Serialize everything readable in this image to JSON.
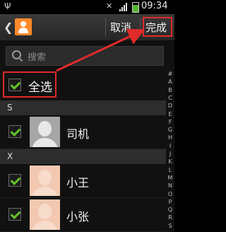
{
  "status_bar": {
    "time": "09:34"
  },
  "action_bar": {
    "cancel_label": "取消",
    "done_label": "完成"
  },
  "search": {
    "placeholder": "搜索"
  },
  "select_all": {
    "label": "全选",
    "checked": true
  },
  "sections": [
    {
      "letter": "S",
      "contacts": [
        {
          "name": "司机",
          "checked": true
        }
      ]
    },
    {
      "letter": "X",
      "contacts": [
        {
          "name": "小王",
          "checked": true
        },
        {
          "name": "小张",
          "checked": true
        }
      ]
    }
  ],
  "index_letters": [
    "#",
    "A",
    "B",
    "C",
    "D",
    "E",
    "F",
    "G",
    "H",
    "I",
    "J",
    "K",
    "L",
    "M",
    "N",
    "O",
    "P",
    "Q",
    "R",
    "S"
  ],
  "colors": {
    "highlight": "#e12a2a",
    "check": "#62c52b",
    "app_icon": "#ff8a2a"
  }
}
